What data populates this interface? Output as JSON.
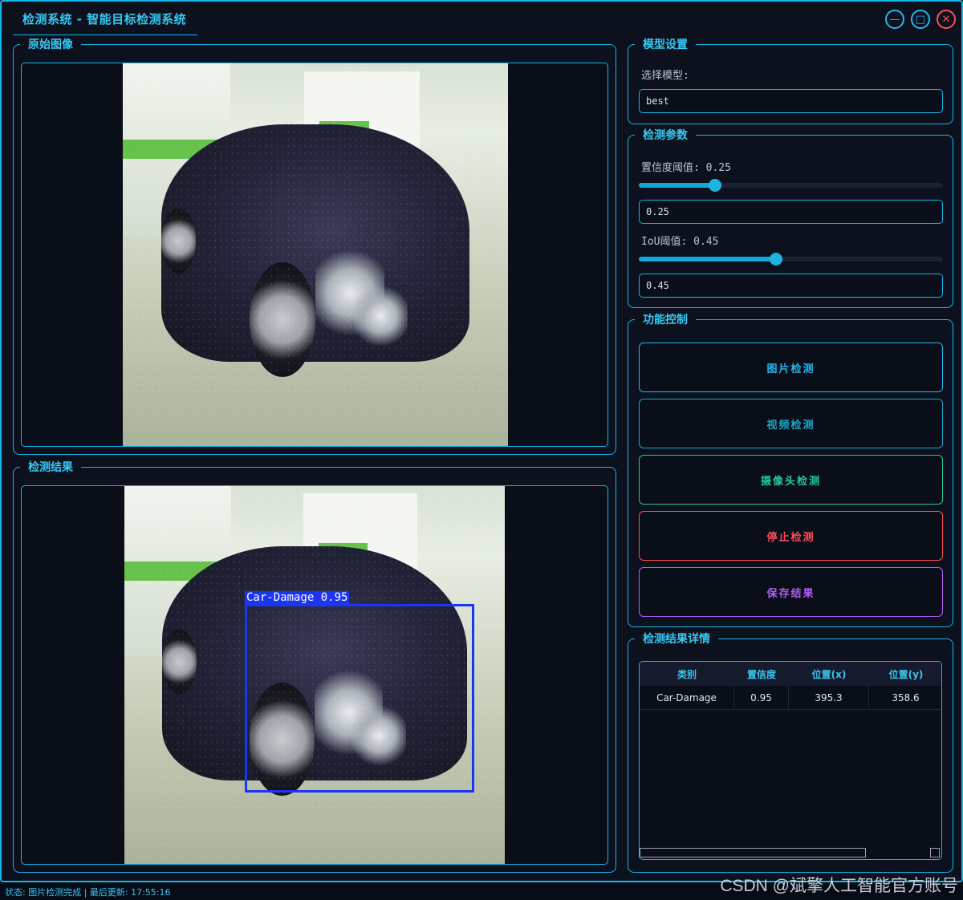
{
  "window": {
    "title": "检测系统 - 智能目标检测系统",
    "buttons": [
      "minimize-icon",
      "maximize-icon",
      "close-icon"
    ]
  },
  "original_panel": {
    "title": "原始图像"
  },
  "result_panel": {
    "title": "检测结果",
    "detection_label": "Car-Damage 0.95"
  },
  "model_settings": {
    "title": "模型设置",
    "select_label": "选择模型:",
    "selected_model": "best"
  },
  "params": {
    "title": "检测参数",
    "conf_label": "置信度阈值: 0.25",
    "conf_value": "0.25",
    "conf_fraction": 0.25,
    "iou_label": "IoU阈值: 0.45",
    "iou_value": "0.45",
    "iou_fraction": 0.45
  },
  "controls": {
    "title": "功能控制",
    "image_detect": "图片检测",
    "video_detect": "视频检测",
    "camera_detect": "摄像头检测",
    "stop_detect": "停止检测",
    "save_result": "保存结果"
  },
  "details": {
    "title": "检测结果详情",
    "columns": [
      "类别",
      "置信度",
      "位置(x)",
      "位置(y)"
    ],
    "rows": [
      [
        "Car-Damage",
        "0.95",
        "395.3",
        "358.6"
      ]
    ]
  },
  "status_bar": "状态: 图片检测完成 | 最后更新: 17:55:16",
  "watermark": "CSDN @斌擎人工智能官方账号",
  "colors": {
    "accent": "#14b6e8",
    "image_btn": "#22b8f0",
    "video_btn": "#1aa7c9",
    "camera_btn": "#22c9a0",
    "stop_btn": "#ff4d57",
    "save_btn": "#b05cf5",
    "bbox": "#1b35f0"
  }
}
